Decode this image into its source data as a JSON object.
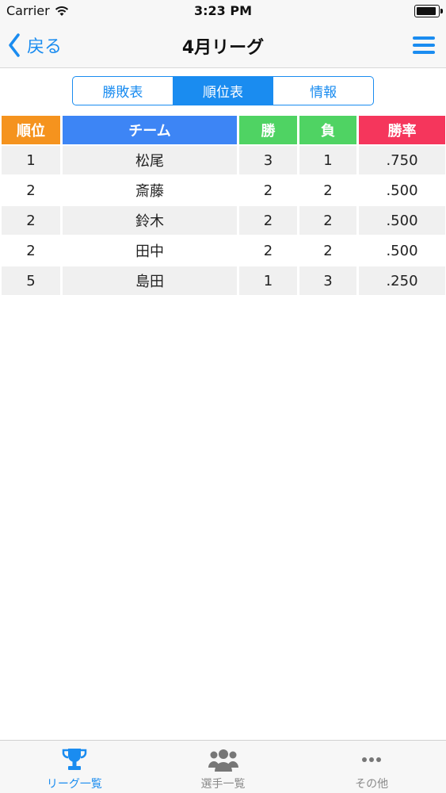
{
  "status_bar": {
    "carrier": "Carrier",
    "time": "3:23 PM"
  },
  "nav": {
    "back_label": "戻る",
    "title": "4月リーグ"
  },
  "segments": [
    {
      "label": "勝敗表",
      "active": false
    },
    {
      "label": "順位表",
      "active": true
    },
    {
      "label": "情報",
      "active": false
    }
  ],
  "table": {
    "headers": [
      {
        "label": "順位",
        "color": "#f5931e"
      },
      {
        "label": "チーム",
        "color": "#3d85f5"
      },
      {
        "label": "勝",
        "color": "#4fd363"
      },
      {
        "label": "負",
        "color": "#4fd363"
      },
      {
        "label": "勝率",
        "color": "#f5365c"
      }
    ],
    "rows": [
      {
        "rank": "1",
        "team": "松尾",
        "wins": "3",
        "losses": "1",
        "pct": ".750"
      },
      {
        "rank": "2",
        "team": "斎藤",
        "wins": "2",
        "losses": "2",
        "pct": ".500"
      },
      {
        "rank": "2",
        "team": "鈴木",
        "wins": "2",
        "losses": "2",
        "pct": ".500"
      },
      {
        "rank": "2",
        "team": "田中",
        "wins": "2",
        "losses": "2",
        "pct": ".500"
      },
      {
        "rank": "5",
        "team": "島田",
        "wins": "1",
        "losses": "3",
        "pct": ".250"
      }
    ]
  },
  "tabs": [
    {
      "label": "リーグ一覧",
      "icon": "trophy-icon",
      "active": true
    },
    {
      "label": "選手一覧",
      "icon": "users-icon",
      "active": false
    },
    {
      "label": "その他",
      "icon": "more-icon",
      "active": false
    }
  ],
  "colors": {
    "accent": "#1a8cf0",
    "inactive": "#8a8a8a"
  }
}
